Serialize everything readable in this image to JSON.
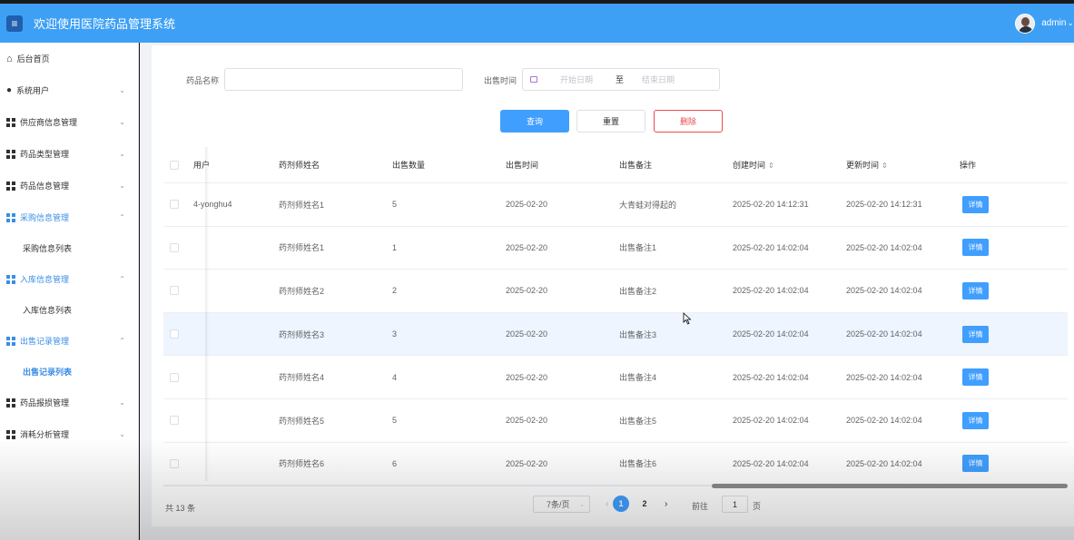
{
  "header": {
    "title": "欢迎使用医院药品管理系统",
    "user": "admin"
  },
  "sidebar": {
    "items": [
      {
        "label": "后台首页"
      },
      {
        "label": "系统用户"
      },
      {
        "label": "供应商信息管理"
      },
      {
        "label": "药品类型管理"
      },
      {
        "label": "药品信息管理"
      },
      {
        "label": "采购信息管理"
      },
      {
        "label": "采购信息列表"
      },
      {
        "label": "入库信息管理"
      },
      {
        "label": "入库信息列表"
      },
      {
        "label": "出售记录管理"
      },
      {
        "label": "出售记录列表"
      },
      {
        "label": "药品报损管理"
      },
      {
        "label": "消耗分析管理"
      }
    ]
  },
  "filters": {
    "drug_name_label": "药品名称",
    "drug_name_value": "",
    "sale_time_label": "出售时间",
    "start_placeholder": "开始日期",
    "range_separator": "至",
    "end_placeholder": "结束日期"
  },
  "actions": {
    "query": "查询",
    "reset": "重置",
    "delete": "删除"
  },
  "table": {
    "columns": [
      "用户",
      "药剂师姓名",
      "出售数量",
      "出售时间",
      "出售备注",
      "创建时间",
      "更新时间",
      "操作"
    ],
    "rows": [
      {
        "user": "4-yonghu4",
        "pharmacist": "药剂师姓名1",
        "qty": "5",
        "sale_time": "2025-02-20",
        "remark": "大青蛙对得起的",
        "created": "2025-02-20 14:12:31",
        "updated": "2025-02-20 14:12:31",
        "action": "详情"
      },
      {
        "user": "",
        "pharmacist": "药剂师姓名1",
        "qty": "1",
        "sale_time": "2025-02-20",
        "remark": "出售备注1",
        "created": "2025-02-20 14:02:04",
        "updated": "2025-02-20 14:02:04",
        "action": "详情"
      },
      {
        "user": "",
        "pharmacist": "药剂师姓名2",
        "qty": "2",
        "sale_time": "2025-02-20",
        "remark": "出售备注2",
        "created": "2025-02-20 14:02:04",
        "updated": "2025-02-20 14:02:04",
        "action": "详情"
      },
      {
        "user": "",
        "pharmacist": "药剂师姓名3",
        "qty": "3",
        "sale_time": "2025-02-20",
        "remark": "出售备注3",
        "created": "2025-02-20 14:02:04",
        "updated": "2025-02-20 14:02:04",
        "action": "详情"
      },
      {
        "user": "",
        "pharmacist": "药剂师姓名4",
        "qty": "4",
        "sale_time": "2025-02-20",
        "remark": "出售备注4",
        "created": "2025-02-20 14:02:04",
        "updated": "2025-02-20 14:02:04",
        "action": "详情"
      },
      {
        "user": "",
        "pharmacist": "药剂师姓名5",
        "qty": "5",
        "sale_time": "2025-02-20",
        "remark": "出售备注5",
        "created": "2025-02-20 14:02:04",
        "updated": "2025-02-20 14:02:04",
        "action": "详情"
      },
      {
        "user": "",
        "pharmacist": "药剂师姓名6",
        "qty": "6",
        "sale_time": "2025-02-20",
        "remark": "出售备注6",
        "created": "2025-02-20 14:02:04",
        "updated": "2025-02-20 14:02:04",
        "action": "详情"
      }
    ]
  },
  "pagination": {
    "total": "共 13 条",
    "page_size": "7条/页",
    "pages": [
      "1",
      "2"
    ],
    "current": "1",
    "goto_label": "前往",
    "goto_value": "1",
    "goto_suffix": "页"
  }
}
